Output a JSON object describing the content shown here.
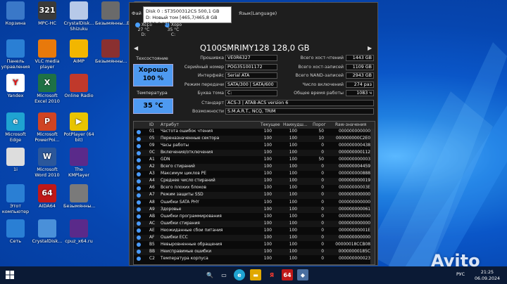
{
  "desktop_icons": [
    {
      "label": "Корзина",
      "icon": "recycle-bin-icon",
      "color": "#3a78c8"
    },
    {
      "label": "MPC-HC",
      "icon": "mpc-hc-icon",
      "color": "#3a3a3a",
      "glyph": "321"
    },
    {
      "label": "CrystalDisk... Shizuku",
      "icon": "crystaldisk-shizuku-icon",
      "color": "#b7c9e8"
    },
    {
      "label": "Безымянны...",
      "icon": "image-file-icon",
      "color": "#6a6a6a"
    },
    {
      "label": "Безымянны...",
      "icon": "image-file-icon",
      "color": "#6a6a6a"
    },
    {
      "label": "Панель управления",
      "icon": "control-panel-icon",
      "color": "#2a7fd4"
    },
    {
      "label": "VLC media player",
      "icon": "vlc-icon",
      "color": "#e8790b"
    },
    {
      "label": "AIMP",
      "icon": "aimp-icon",
      "color": "#f2b600"
    },
    {
      "label": "Безымянны...",
      "icon": "image-file-icon",
      "color": "#8a3030"
    },
    {
      "label": "Yandex",
      "icon": "yandex-icon",
      "color": "#ffffff",
      "glyph": "Y",
      "glyphColor": "#e31b1b"
    },
    {
      "label": "Microsoft Excel 2010",
      "icon": "excel-icon",
      "color": "#1e7145",
      "glyph": "X"
    },
    {
      "label": "Online Radio",
      "icon": "online-radio-icon",
      "color": "#c0392b"
    },
    {
      "label": "Microsoft Edge",
      "icon": "edge-icon",
      "color": "#1fa3d1",
      "glyph": "e"
    },
    {
      "label": "Microsoft PowerPoi...",
      "icon": "powerpoint-icon",
      "color": "#d04423",
      "glyph": "P"
    },
    {
      "label": "PotPlayer (64 bit)",
      "icon": "potplayer-icon",
      "color": "#e8c400",
      "glyph": "▶"
    },
    {
      "label": "1i",
      "icon": "file-icon",
      "color": "#dddddd"
    },
    {
      "label": "Microsoft Word 2010",
      "icon": "word-icon",
      "color": "#2b579a",
      "glyph": "W"
    },
    {
      "label": "The KMPlayer",
      "icon": "kmplayer-icon",
      "color": "#5a2a8a"
    },
    {
      "label": "Этот компьютер",
      "icon": "this-pc-icon",
      "color": "#2a7fd4"
    },
    {
      "label": "AIDA64",
      "icon": "aida64-icon",
      "color": "#c01818",
      "glyph": "64"
    },
    {
      "label": "Безымянны...",
      "icon": "image-file-icon",
      "color": "#7a7a7a"
    },
    {
      "label": "Сеть",
      "icon": "network-icon",
      "color": "#2a7fd4"
    },
    {
      "label": "CrystalDisk...",
      "icon": "crystaldisk-icon",
      "color": "#4a90d9"
    },
    {
      "label": "cpuz_x64.ru",
      "icon": "cpuz-icon",
      "color": "#5a2a8a"
    }
  ],
  "window": {
    "menu": {
      "file": "Фай",
      "lang": "Язык(Language)"
    },
    "tooltip": {
      "line1": "Disk 0 : ST3500312CS 500,1 GB",
      "line2": "D: Новый том [465,7/465,8 GB (100,0 %)]"
    },
    "disks": [
      {
        "status": "Хоро",
        "temp": "27 °C",
        "letter": "D:"
      },
      {
        "status": "Хоро",
        "temp": "35 °C",
        "letter": "C:"
      }
    ],
    "model": "Q100SMRIMY128 128,0 GB",
    "tech_label": "Техсостояние",
    "health_status": "Хорошо",
    "health_percent": "100 %",
    "temp_label": "Температура",
    "temp_value": "35 °C",
    "left_fields": [
      {
        "label": "Прошивка",
        "value": "VE0R6327"
      },
      {
        "label": "Серийный номер",
        "value": "POG351001172"
      },
      {
        "label": "Интерфейс",
        "value": "Serial ATA"
      },
      {
        "label": "Режим передачи",
        "value": "SATA/300 | SATA/600"
      },
      {
        "label": "Буква тома",
        "value": "C:"
      }
    ],
    "right_fields": [
      {
        "label": "Всего хост-чтений",
        "value": "1443 GB"
      },
      {
        "label": "Всего хост-записей",
        "value": "1109 GB"
      },
      {
        "label": "Всего NAND-записей",
        "value": "2943 GB"
      },
      {
        "label": "Число включений",
        "value": "274 раз"
      },
      {
        "label": "Общее время работы",
        "value": "1083 ч"
      }
    ],
    "standard_label": "Стандарт",
    "standard_value": "ACS-3 | ATA8-ACS version 6",
    "features_label": "Возможности",
    "features_value": "S.M.A.R.T., NCQ, TRIM",
    "table_headers": {
      "id": "ID",
      "attr": "Атрибут",
      "cur": "Текущее",
      "worst": "Наихудш...",
      "thr": "Порог",
      "raw": "Raw-значения"
    },
    "smart_rows": [
      {
        "id": "01",
        "attr": "Частота ошибок чтения",
        "cur": "100",
        "worst": "100",
        "thr": "50",
        "raw": "000000000000"
      },
      {
        "id": "05",
        "attr": "Переназначенные сектора",
        "cur": "100",
        "worst": "100",
        "thr": "10",
        "raw": "000000000C2E0"
      },
      {
        "id": "09",
        "attr": "Часы работы",
        "cur": "100",
        "worst": "100",
        "thr": "0",
        "raw": "000000000438"
      },
      {
        "id": "0C",
        "attr": "Включения/отключения",
        "cur": "100",
        "worst": "100",
        "thr": "0",
        "raw": "000000000112"
      },
      {
        "id": "A1",
        "attr": "GDN",
        "cur": "100",
        "worst": "100",
        "thr": "50",
        "raw": "000000000003"
      },
      {
        "id": "A2",
        "attr": "Всего стираний",
        "cur": "100",
        "worst": "100",
        "thr": "0",
        "raw": "000000004459"
      },
      {
        "id": "A3",
        "attr": "Максимум циклов PE",
        "cur": "100",
        "worst": "100",
        "thr": "0",
        "raw": "000000000888"
      },
      {
        "id": "A4",
        "attr": "Среднее число стираний",
        "cur": "100",
        "worst": "100",
        "thr": "0",
        "raw": "000000000019"
      },
      {
        "id": "A6",
        "attr": "Всего плохих блоков",
        "cur": "100",
        "worst": "100",
        "thr": "0",
        "raw": "00000000003E"
      },
      {
        "id": "A7",
        "attr": "Режим защиты SSD",
        "cur": "100",
        "worst": "100",
        "thr": "0",
        "raw": "000000000000"
      },
      {
        "id": "A8",
        "attr": "Ошибки SATA PHY",
        "cur": "100",
        "worst": "100",
        "thr": "0",
        "raw": "000000000000"
      },
      {
        "id": "A9",
        "attr": "Здоровье",
        "cur": "100",
        "worst": "100",
        "thr": "0",
        "raw": "000000000061"
      },
      {
        "id": "AB",
        "attr": "Ошибки программирования",
        "cur": "100",
        "worst": "100",
        "thr": "0",
        "raw": "000000000000"
      },
      {
        "id": "AC",
        "attr": "Ошибки стирания",
        "cur": "100",
        "worst": "100",
        "thr": "0",
        "raw": "000000000000"
      },
      {
        "id": "AE",
        "attr": "Неожиданные сбои питания",
        "cur": "100",
        "worst": "100",
        "thr": "0",
        "raw": "00000000001E"
      },
      {
        "id": "AF",
        "attr": "Ошибки ECC",
        "cur": "100",
        "worst": "100",
        "thr": "0",
        "raw": "000000000000"
      },
      {
        "id": "B5",
        "attr": "Невыровненные обращения",
        "cur": "100",
        "worst": "100",
        "thr": "0",
        "raw": "00000018CCB08"
      },
      {
        "id": "BB",
        "attr": "Неисправимые ошибки",
        "cur": "100",
        "worst": "100",
        "thr": "0",
        "raw": "00000000185C"
      },
      {
        "id": "C2",
        "attr": "Температура корпуса",
        "cur": "100",
        "worst": "100",
        "thr": "0",
        "raw": "000000000023"
      }
    ]
  },
  "taskbar": {
    "tray_lang": "РУС",
    "clock_time": "21:25",
    "clock_date": "06.09.2024",
    "avito": "Avito"
  }
}
